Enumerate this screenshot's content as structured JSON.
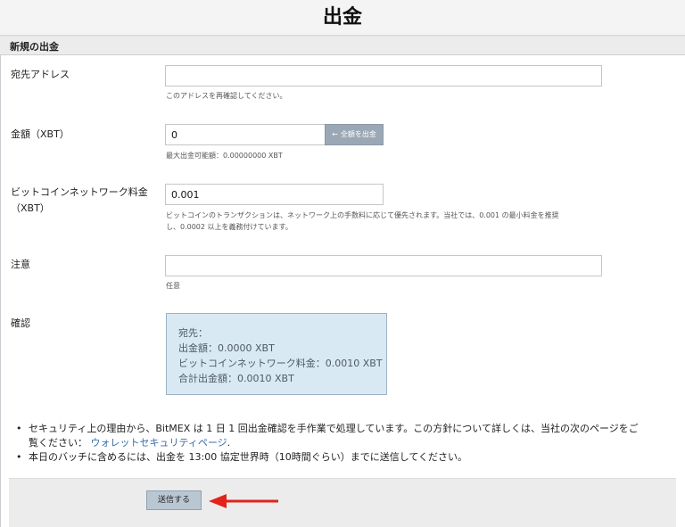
{
  "header": {
    "title": "出金"
  },
  "section": {
    "title": "新規の出金"
  },
  "address": {
    "label": "宛先アドレス",
    "value": "",
    "help": "このアドレスを再確認してください。"
  },
  "amount": {
    "label": "金額（XBT）",
    "value": "0",
    "all_button": "全額を出金",
    "help": "最大出金可能額：0.00000000 XBT"
  },
  "fee": {
    "label_line1": "ビットコインネットワーク料金",
    "label_line2": "（XBT）",
    "value": "0.001",
    "help_line1": "ビットコインのトランザクションは、ネットワーク上の手数料に応じて優先されます。当社では、0.001 の最小料金を推奨",
    "help_line2": "し、0.0002 以上を義務付けています。"
  },
  "note": {
    "label": "注意",
    "value": "",
    "help": "任意"
  },
  "confirm": {
    "label": "確認",
    "lines": [
      "宛先：",
      "出金額：0.0000 XBT",
      "ビットコインネットワーク料金：0.0010 XBT",
      "合計出金額：0.0010 XBT"
    ]
  },
  "notes": {
    "item1_line1": "セキュリティ上の理由から、BitMEX は 1 日 1 回出金確認を手作業で処理しています。この方針について詳しくは、当社の次のページをご",
    "item1_line2_prefix": "覧ください：",
    "item1_link": "ウォレットセキュリティページ",
    "item1_suffix": ".",
    "item2": "本日のバッチに含めるには、出金を 13:00 協定世界時（10時間ぐらい）までに送信してください。"
  },
  "footer": {
    "submit_label": "送信する"
  },
  "colors": {
    "confirm_bg": "#d9e9f3",
    "all_button_bg": "#9aa8b6",
    "submit_bg": "#b9c7d3",
    "arrow": "#e2231a",
    "link": "#3b6ea8"
  },
  "icons": {
    "all_button_icon": "arrow-left-icon",
    "annotation": "red-arrow-icon"
  }
}
